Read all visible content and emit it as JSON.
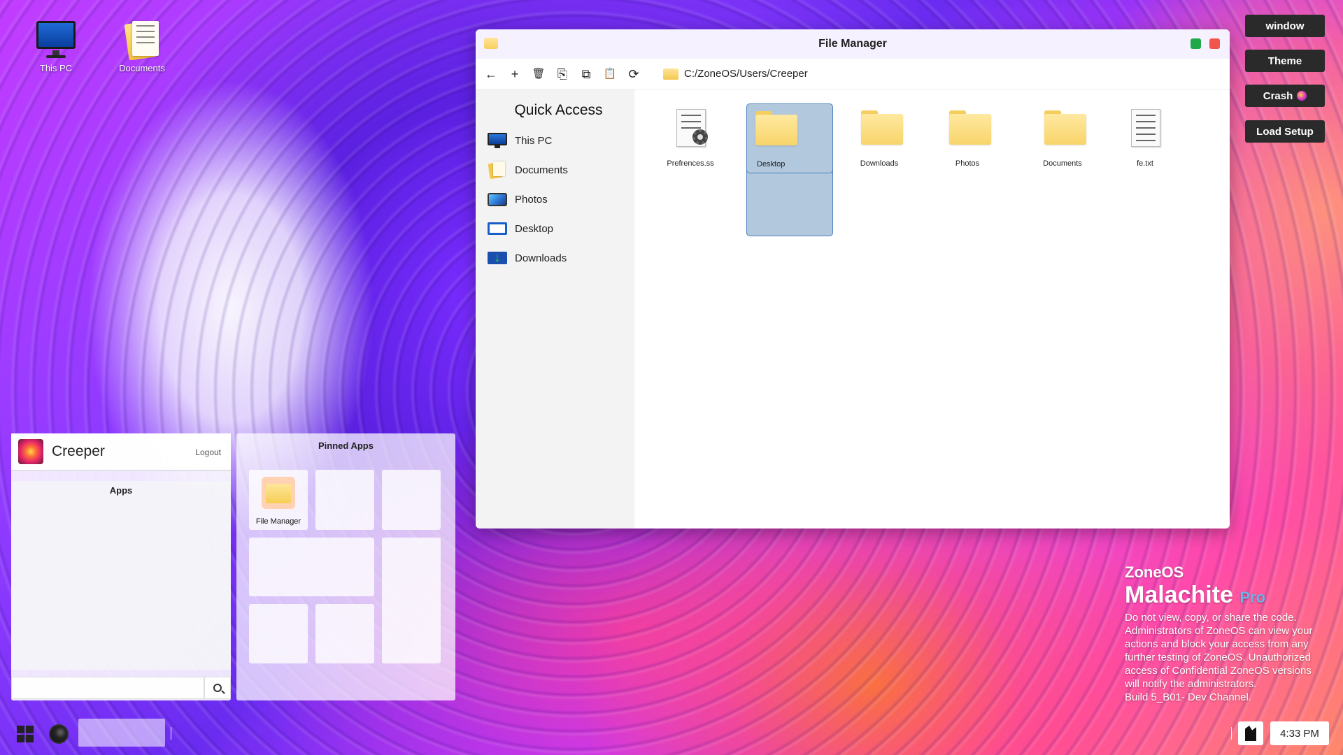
{
  "desktop": {
    "icons": [
      {
        "label": "This PC",
        "icon": "monitor-icon"
      },
      {
        "label": "Documents",
        "icon": "documents-icon"
      }
    ]
  },
  "side_buttons": {
    "window": "window",
    "theme": "Theme",
    "crash": "Crash",
    "load_setup": "Load Setup"
  },
  "file_manager": {
    "title": "File Manager",
    "toolbar": {
      "back": "←",
      "new": "+",
      "delete": "🗑",
      "rename": "⎘",
      "copy": "⧉",
      "paste": "📋",
      "refresh": "⟳"
    },
    "path": "C:/ZoneOS/Users/Creeper",
    "sidebar": {
      "title": "Quick Access",
      "items": [
        {
          "label": "This PC",
          "icon": "monitor-icon"
        },
        {
          "label": "Documents",
          "icon": "documents-icon"
        },
        {
          "label": "Photos",
          "icon": "photos-icon"
        },
        {
          "label": "Desktop",
          "icon": "desktop-icon"
        },
        {
          "label": "Downloads",
          "icon": "downloads-icon"
        }
      ]
    },
    "files": [
      {
        "name": "Prefrences.ss",
        "type": "settings-file"
      },
      {
        "name": "Desktop",
        "type": "folder",
        "selected": true
      },
      {
        "name": "Downloads",
        "type": "folder"
      },
      {
        "name": "Photos",
        "type": "folder"
      },
      {
        "name": "Documents",
        "type": "folder"
      },
      {
        "name": "fe.txt",
        "type": "text-file"
      }
    ]
  },
  "start_menu": {
    "user_name": "Creeper",
    "logout": "Logout",
    "apps_title": "Apps",
    "search_placeholder": "",
    "pinned_title": "Pinned Apps",
    "pinned": [
      {
        "label": "File Manager",
        "icon": "file-manager-icon"
      }
    ]
  },
  "watermark": {
    "os": "ZoneOS",
    "edition": "Malachite",
    "tier": "Pro",
    "lines": [
      "Do not view, copy, or share the code.",
      "Administrators of ZoneOS can view your",
      "actions and block your access from any",
      "further testing of ZoneOS. Unauthorized",
      "access of Confidential ZoneOS versions",
      "will notify the administrators.",
      "Build 5_B01- Dev Channel."
    ]
  },
  "taskbar": {
    "clock": "4:33 PM"
  },
  "colors": {
    "win_green": "#1ea84a",
    "win_red": "#f0544c",
    "selected_tile": "#b2c8dc",
    "button_dark": "#2a2a2a"
  }
}
